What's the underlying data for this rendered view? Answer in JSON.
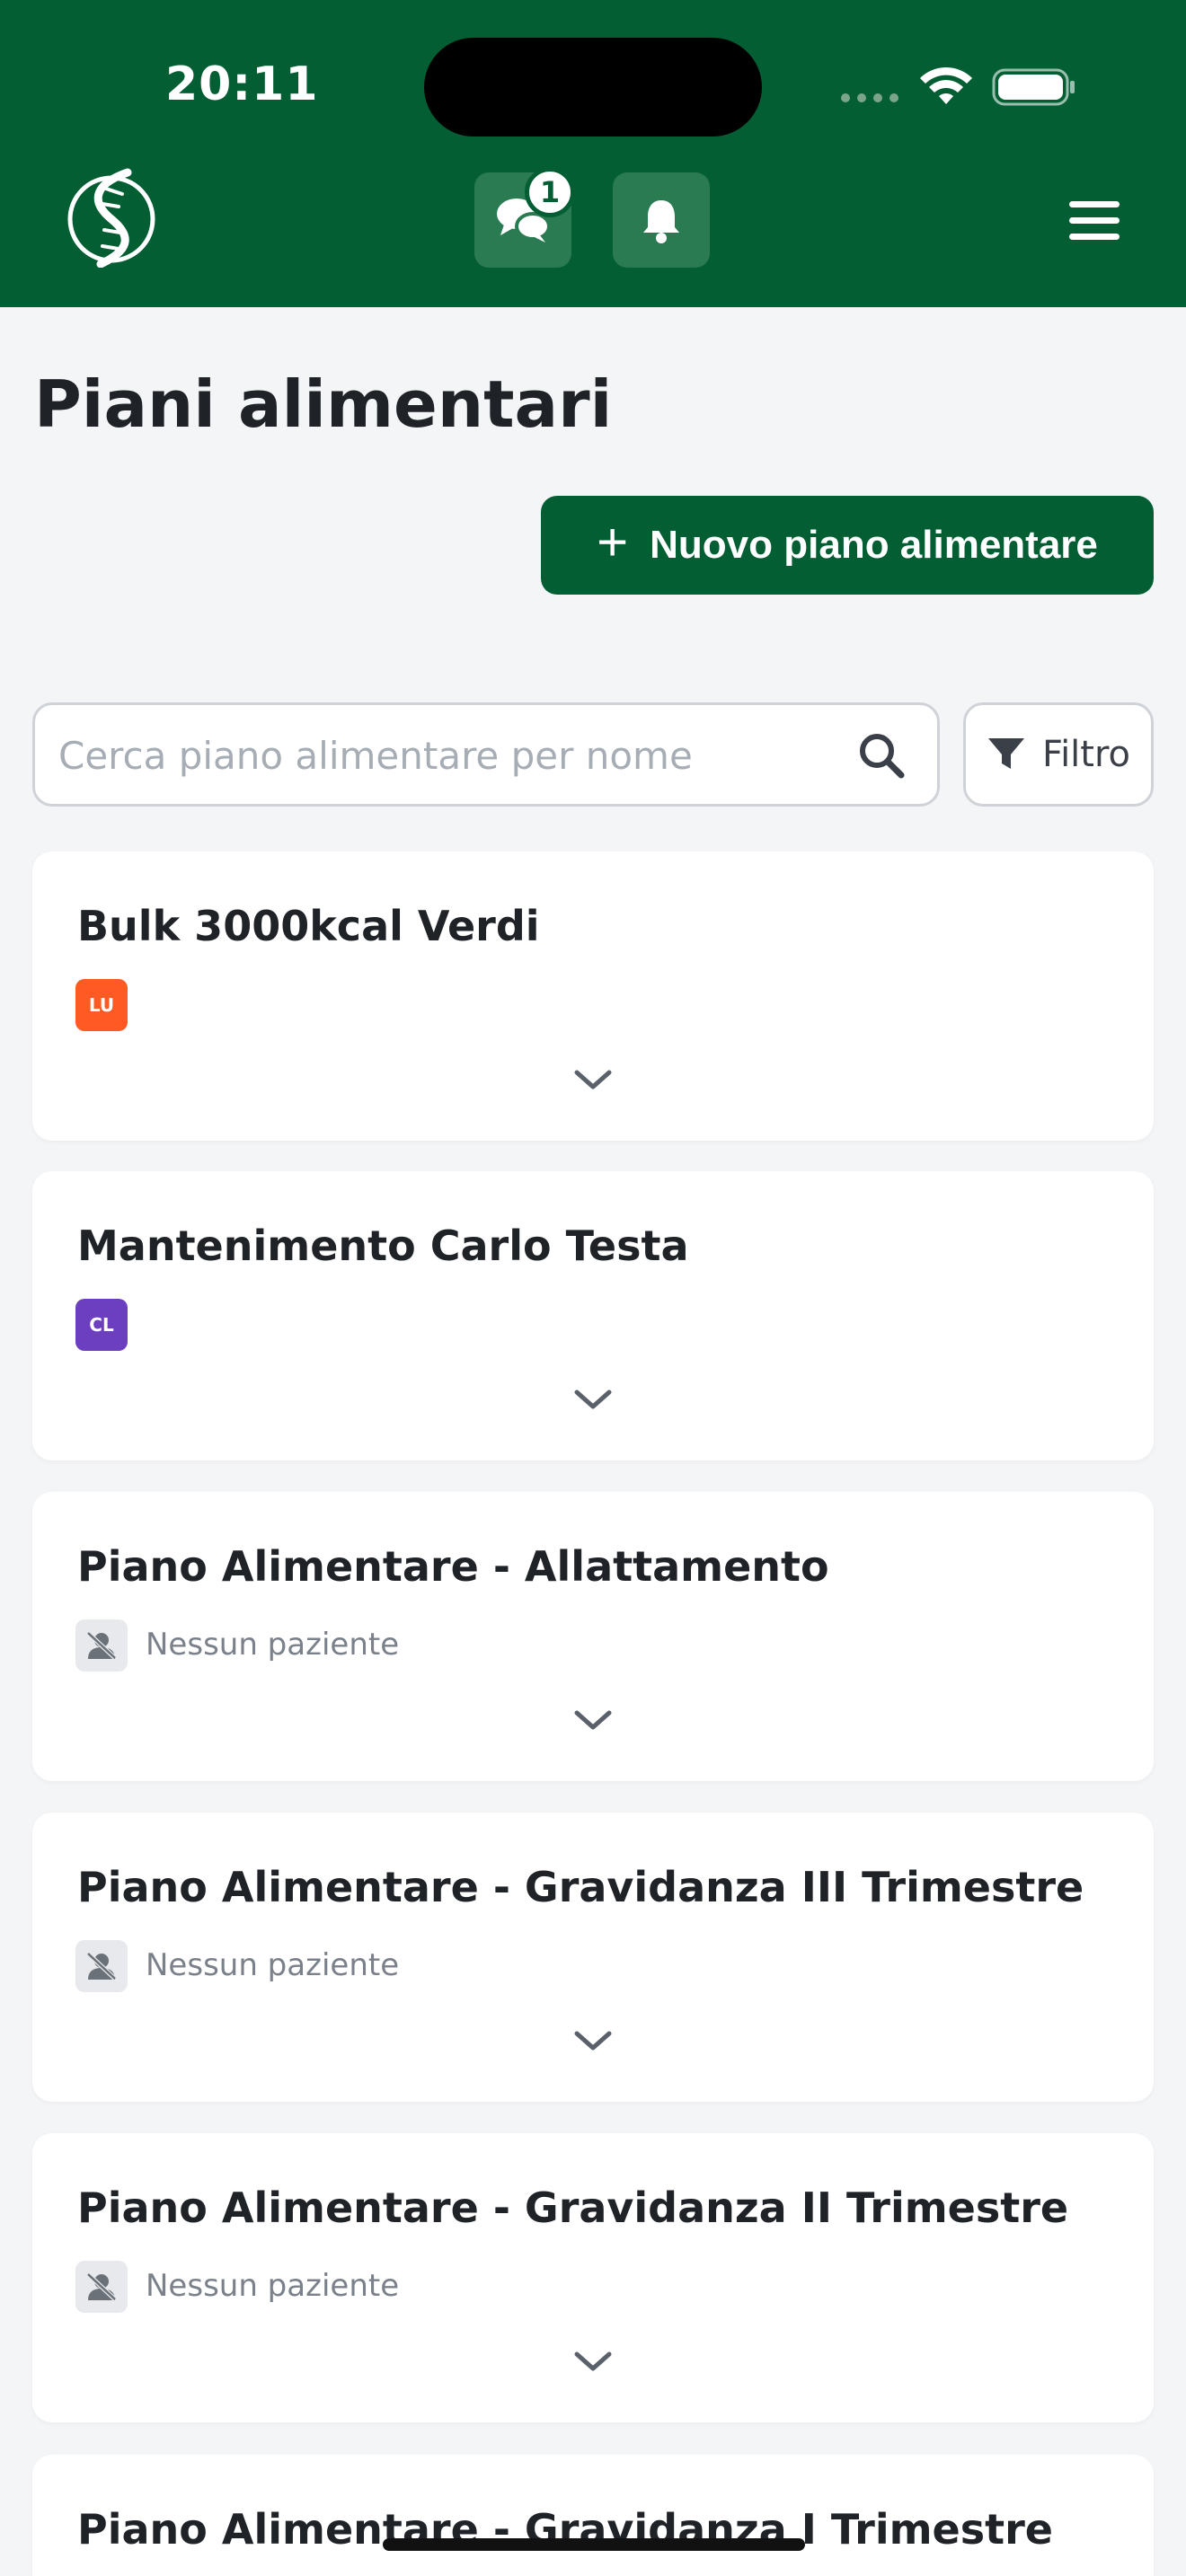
{
  "status_bar": {
    "time": "20:11"
  },
  "header": {
    "chat_badge_count": "1",
    "logo_icon": "dna-helix-icon",
    "chat_icon": "chat-bubbles-icon",
    "bell_icon": "bell-icon",
    "menu_icon": "hamburger-menu-icon",
    "brand_color": "#035e33"
  },
  "page": {
    "title": "Piani alimentari",
    "new_button_label": "Nuovo piano alimentare"
  },
  "search": {
    "placeholder": "Cerca piano alimentare per nome",
    "value": "",
    "filter_label": "Filtro"
  },
  "plans": [
    {
      "name": "Bulk 3000kcal Verdi",
      "patient_initials": "LU",
      "patient_color": "#ff5a23"
    },
    {
      "name": "Mantenimento Carlo Testa",
      "patient_initials": "CL",
      "patient_color": "#6b3fbf"
    },
    {
      "name": "Piano Alimentare - Allattamento",
      "patient_label": "Nessun paziente"
    },
    {
      "name": "Piano Alimentare - Gravidanza III Trimestre",
      "patient_label": "Nessun paziente"
    },
    {
      "name": "Piano Alimentare - Gravidanza II Trimestre",
      "patient_label": "Nessun paziente"
    },
    {
      "name": "Piano Alimentare - Gravidanza I Trimestre"
    }
  ]
}
